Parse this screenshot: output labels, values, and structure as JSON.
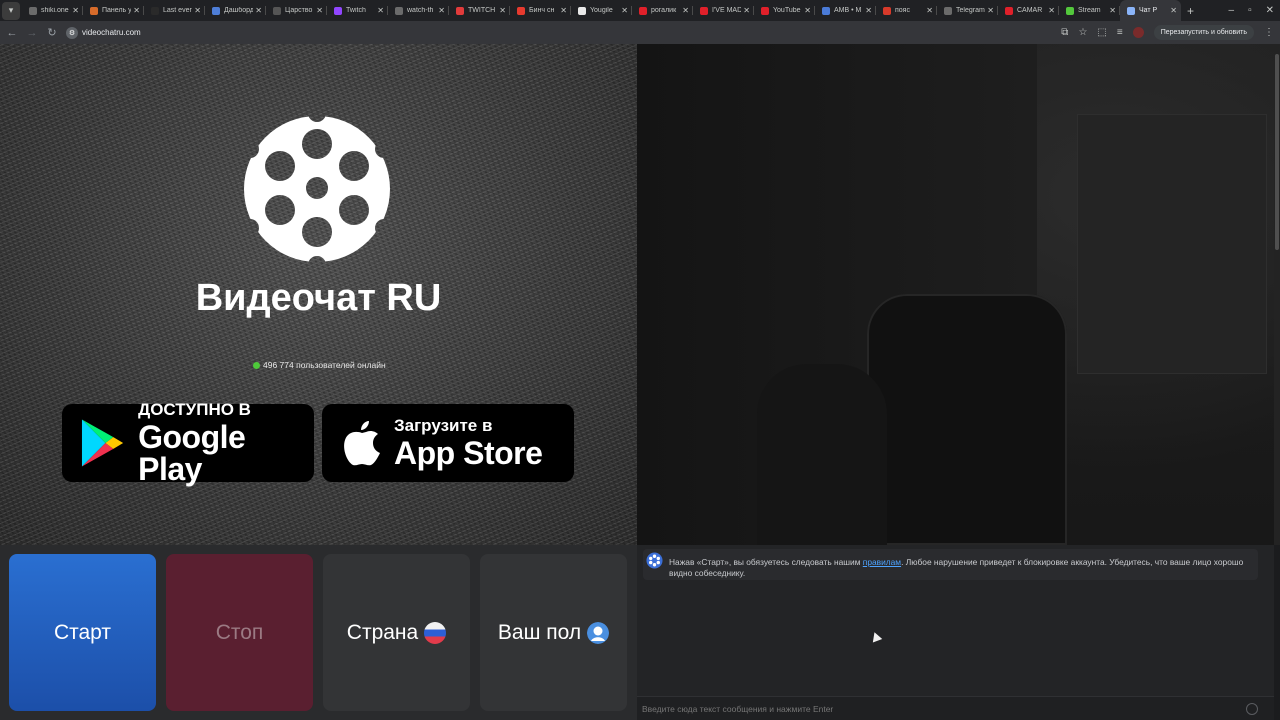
{
  "browser": {
    "tabs": [
      {
        "title": "shiki.one",
        "color": "#6b6b6b"
      },
      {
        "title": "Панель у",
        "color": "#d76b2a"
      },
      {
        "title": "Last ever",
        "color": "#2a2a2a"
      },
      {
        "title": "Дашборд",
        "color": "#4e7ed8"
      },
      {
        "title": "Царство",
        "color": "#555555"
      },
      {
        "title": "Twitch",
        "color": "#9146ff"
      },
      {
        "title": "watch-th",
        "color": "#6b6b6b"
      },
      {
        "title": "TWITCH",
        "color": "#e23b3b"
      },
      {
        "title": "Бинч сн",
        "color": "#e83a2e"
      },
      {
        "title": "Yougile",
        "color": "#e8e8e8"
      },
      {
        "title": "рогалик",
        "color": "#e0202a"
      },
      {
        "title": "I'VE MAD",
        "color": "#e0202a"
      },
      {
        "title": "YouTube",
        "color": "#e0202a"
      },
      {
        "title": "AMB • M",
        "color": "#4a7bd8"
      },
      {
        "title": "пояс",
        "color": "#d83a2a"
      },
      {
        "title": "Telegram",
        "color": "#6b6b6b"
      },
      {
        "title": "CAMAR",
        "color": "#e0202a"
      },
      {
        "title": "Stream",
        "color": "#53c83c"
      },
      {
        "title": "Чат Р",
        "color": "#8ab4f8",
        "active": true
      }
    ],
    "url": "videochatru.com",
    "relaunch_label": "Перезапустить и обновить"
  },
  "left": {
    "brand": "Видеочат RU",
    "online_text": "496 774 пользователей онлайн",
    "google_play": {
      "small": "ДОСТУПНО В",
      "big": "Google Play"
    },
    "app_store": {
      "small": "Загрузите в",
      "big": "App Store"
    }
  },
  "controls": {
    "start": "Старт",
    "stop": "Стоп",
    "country": "Страна",
    "gender": "Ваш пол"
  },
  "chat": {
    "msg_prefix": "Нажав «Старт», вы обязуетесь следовать нашим ",
    "msg_link": "правилам",
    "msg_suffix": ". Любое нарушение приведет к блокировке аккаунта. Убедитесь, что ваше лицо хорошо видно собеседнику.",
    "input_placeholder": "Введите сюда текст сообщения и нажмите Enter"
  }
}
